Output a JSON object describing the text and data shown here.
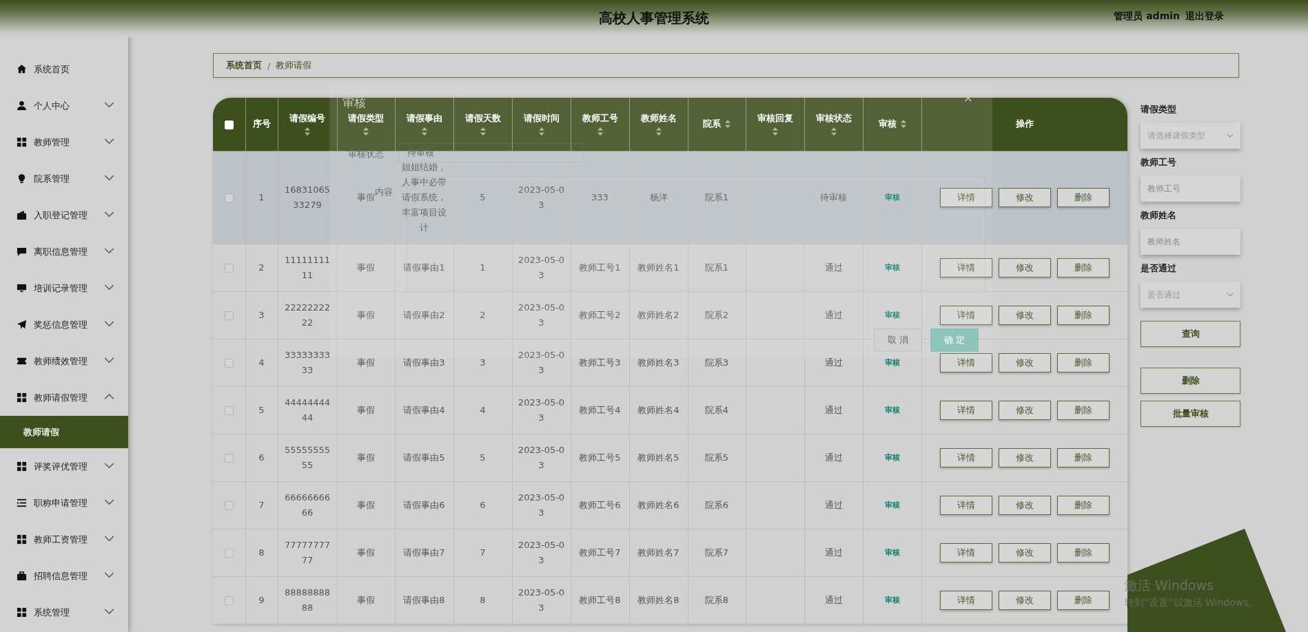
{
  "header": {
    "title": "高校人事管理系统",
    "user": "管理员 admin",
    "logout": "退出登录"
  },
  "sidebar": {
    "items": [
      {
        "label": "系统首页"
      },
      {
        "label": "个人中心",
        "expanded": false
      },
      {
        "label": "教师管理",
        "expanded": false
      },
      {
        "label": "院系管理",
        "expanded": false
      },
      {
        "label": "入职登记管理",
        "expanded": false
      },
      {
        "label": "离职信息管理",
        "expanded": false
      },
      {
        "label": "培训记录管理",
        "expanded": false
      },
      {
        "label": "奖惩信息管理",
        "expanded": false
      },
      {
        "label": "教师绩效管理",
        "expanded": false
      },
      {
        "label": "教师请假管理",
        "expanded": true,
        "children": [
          {
            "label": "教师请假",
            "selected": true
          }
        ]
      },
      {
        "label": "评奖评优管理",
        "expanded": false
      },
      {
        "label": "职称申请管理",
        "expanded": false
      },
      {
        "label": "教师工资管理",
        "expanded": false
      },
      {
        "label": "招聘信息管理",
        "expanded": false
      },
      {
        "label": "系统管理",
        "expanded": false
      }
    ]
  },
  "breadcrumb": {
    "items": [
      "系统首页",
      "教师请假"
    ],
    "separator": "/"
  },
  "table": {
    "select_all": {
      "checked": false
    },
    "columns": [
      {
        "label": "序号",
        "sortable": false
      },
      {
        "label": "请假编号",
        "sortable": true,
        "sort_beside": false
      },
      {
        "label": "请假类型",
        "sortable": true,
        "sort_beside": false
      },
      {
        "label": "请假事由",
        "sortable": true,
        "sort_beside": false
      },
      {
        "label": "请假天数",
        "sortable": true,
        "sort_beside": false
      },
      {
        "label": "请假时间",
        "sortable": true,
        "sort_beside": false
      },
      {
        "label": "教师工号",
        "sortable": true,
        "sort_beside": false
      },
      {
        "label": "教师姓名",
        "sortable": true,
        "sort_beside": false
      },
      {
        "label": "院系",
        "sortable": true,
        "sort_beside": true
      },
      {
        "label": "审核回复",
        "sortable": true,
        "sort_beside": false
      },
      {
        "label": "审核状态",
        "sortable": true,
        "sort_beside": false
      },
      {
        "label": "审核",
        "sortable": true,
        "sort_beside": true
      },
      {
        "label": "操作",
        "sortable": false
      }
    ],
    "rows": [
      {
        "checked": false,
        "highlighted": true,
        "cells": [
          "1",
          "1683106533279",
          "事假",
          "姐姐结婚，人事中必带请假系统，丰富项目设计",
          "5",
          "2023-05-03",
          "333",
          "杨洋",
          "院系1",
          null,
          "待审核"
        ],
        "review_link": "审核",
        "actions": [
          "详情",
          "修改",
          "删除"
        ]
      },
      {
        "checked": false,
        "highlighted": false,
        "cells": [
          "2",
          "1111111111",
          "事假",
          "请假事由1",
          "1",
          "2023-05-03",
          "教师工号1",
          "教师姓名1",
          "院系1",
          null,
          "通过"
        ],
        "review_link": "审核",
        "actions": [
          "详情",
          "修改",
          "删除"
        ]
      },
      {
        "checked": false,
        "highlighted": false,
        "cells": [
          "3",
          "2222222222",
          "事假",
          "请假事由2",
          "2",
          "2023-05-03",
          "教师工号2",
          "教师姓名2",
          "院系2",
          null,
          "通过"
        ],
        "review_link": "审核",
        "actions": [
          "详情",
          "修改",
          "删除"
        ]
      },
      {
        "checked": false,
        "highlighted": false,
        "cells": [
          "4",
          "3333333333",
          "事假",
          "请假事由3",
          "3",
          "2023-05-03",
          "教师工号3",
          "教师姓名3",
          "院系3",
          null,
          "通过"
        ],
        "review_link": "审核",
        "actions": [
          "详情",
          "修改",
          "删除"
        ]
      },
      {
        "checked": false,
        "highlighted": false,
        "cells": [
          "5",
          "4444444444",
          "事假",
          "请假事由4",
          "4",
          "2023-05-03",
          "教师工号4",
          "教师姓名4",
          "院系4",
          null,
          "通过"
        ],
        "review_link": "审核",
        "actions": [
          "详情",
          "修改",
          "删除"
        ]
      },
      {
        "checked": false,
        "highlighted": false,
        "cells": [
          "6",
          "5555555555",
          "事假",
          "请假事由5",
          "5",
          "2023-05-03",
          "教师工号5",
          "教师姓名5",
          "院系5",
          null,
          "通过"
        ],
        "review_link": "审核",
        "actions": [
          "详情",
          "修改",
          "删除"
        ]
      },
      {
        "checked": false,
        "highlighted": false,
        "cells": [
          "7",
          "6666666666",
          "事假",
          "请假事由6",
          "6",
          "2023-05-03",
          "教师工号6",
          "教师姓名6",
          "院系6",
          null,
          "通过"
        ],
        "review_link": "审核",
        "actions": [
          "详情",
          "修改",
          "删除"
        ]
      },
      {
        "checked": false,
        "highlighted": false,
        "cells": [
          "8",
          "7777777777",
          "事假",
          "请假事由7",
          "7",
          "2023-05-03",
          "教师工号7",
          "教师姓名7",
          "院系7",
          null,
          "通过"
        ],
        "review_link": "审核",
        "actions": [
          "详情",
          "修改",
          "删除"
        ]
      },
      {
        "checked": false,
        "highlighted": false,
        "cells": [
          "9",
          "8888888888",
          "事假",
          "请假事由8",
          "8",
          "2023-05-03",
          "教师工号8",
          "教师姓名8",
          "院系8",
          null,
          "通过"
        ],
        "review_link": "审核",
        "actions": [
          "详情",
          "修改",
          "删除"
        ]
      }
    ]
  },
  "filters": {
    "fields": [
      {
        "kind": "select",
        "label": "请假类型",
        "placeholder": "请选择请假类型"
      },
      {
        "kind": "input",
        "label": "教师工号",
        "placeholder": "教师工号"
      },
      {
        "kind": "input",
        "label": "教师姓名",
        "placeholder": "教师姓名"
      },
      {
        "kind": "select",
        "label": "是否通过",
        "placeholder": "是否通过"
      }
    ],
    "search_button": "查询",
    "buttons": [
      "删除",
      "批量审核"
    ]
  },
  "review_dialog": {
    "title": "审核",
    "close": "×",
    "status_label": "审核状态",
    "status_value": "待审核",
    "content_label": "内容",
    "cancel": "取 消",
    "confirm": "确 定"
  },
  "os_notice": {
    "title": "激活 Windows",
    "text": "转到“设置”以激活 Windows。"
  }
}
